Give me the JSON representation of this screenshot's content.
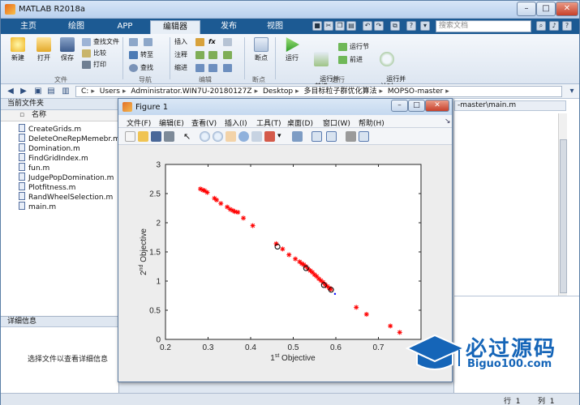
{
  "window": {
    "title": "MATLAB R2018a"
  },
  "ribbon_tabs": [
    {
      "label": "主页"
    },
    {
      "label": "绘图"
    },
    {
      "label": "APP"
    },
    {
      "label": "编辑器"
    },
    {
      "label": "发布"
    },
    {
      "label": "视图"
    }
  ],
  "search": {
    "placeholder": "搜索文档"
  },
  "ribbon": {
    "file": {
      "new": "新建",
      "open": "打开",
      "save": "保存",
      "find_files": "查找文件",
      "compare": "比较",
      "print": "打印",
      "group": "文件"
    },
    "nav": {
      "goto": "转至",
      "find": "查找",
      "group": "导航"
    },
    "edit": {
      "insert": "插入",
      "fx": "fx",
      "comment": "注释",
      "indent": "缩进",
      "group": "编辑"
    },
    "breakpoints": {
      "label": "断点",
      "group": "断点"
    },
    "run": {
      "run": "运行",
      "run_advance": "运行并\n前进",
      "run_section": "运行节",
      "advance": "前进",
      "run_time": "运行并\n计时",
      "group": "运行"
    }
  },
  "address": {
    "segments": [
      "C:",
      "Users",
      "Administrator.WIN7U-20180127Z",
      "Desktop",
      "多目标粒子群优化算法",
      "MOPSO-master"
    ]
  },
  "file_panel": {
    "title": "当前文件夹",
    "column": "名称",
    "files": [
      "CreateGrids.m",
      "DeleteOneRepMemebr.m",
      "Domination.m",
      "FindGridIndex.m",
      "fun.m",
      "JudgePopDomination.m",
      "Plotfitness.m",
      "RandWheelSelection.m",
      "main.m"
    ]
  },
  "details": {
    "title": "详细信息",
    "message": "选择文件以查看详细信息"
  },
  "editor": {
    "tab": "-master\\main.m"
  },
  "status": {
    "row_label": "行",
    "row_value": "1",
    "col_label": "列",
    "col_value": "1"
  },
  "figure": {
    "title": "Figure 1",
    "menus": [
      "文件(F)",
      "编辑(E)",
      "查看(V)",
      "插入(I)",
      "工具(T)",
      "桌面(D)",
      "窗口(W)",
      "帮助(H)"
    ]
  },
  "chart_data": {
    "type": "scatter",
    "xlabel": "1st Objective",
    "ylabel": "2nd Objective",
    "xlim": [
      0.2,
      0.8
    ],
    "ylim": [
      0,
      3
    ],
    "xticks": [
      "0.2",
      "0.3",
      "0.4",
      "0.5",
      "0.6",
      "0.7",
      "0.8"
    ],
    "yticks": [
      "0",
      "0.5",
      "1",
      "1.5",
      "2",
      "2.5",
      "3"
    ],
    "grid": false,
    "series": [
      {
        "marker": "star",
        "color": "#ff0000",
        "points": [
          [
            0.282,
            2.58
          ],
          [
            0.288,
            2.56
          ],
          [
            0.292,
            2.55
          ],
          [
            0.298,
            2.52
          ],
          [
            0.315,
            2.42
          ],
          [
            0.32,
            2.39
          ],
          [
            0.33,
            2.33
          ],
          [
            0.345,
            2.27
          ],
          [
            0.352,
            2.23
          ],
          [
            0.358,
            2.21
          ],
          [
            0.363,
            2.19
          ],
          [
            0.37,
            2.18
          ],
          [
            0.383,
            2.08
          ],
          [
            0.405,
            1.95
          ],
          [
            0.46,
            1.64
          ],
          [
            0.475,
            1.55
          ],
          [
            0.49,
            1.45
          ],
          [
            0.505,
            1.38
          ],
          [
            0.515,
            1.33
          ],
          [
            0.52,
            1.3
          ],
          [
            0.525,
            1.28
          ],
          [
            0.53,
            1.25
          ],
          [
            0.535,
            1.21
          ],
          [
            0.54,
            1.18
          ],
          [
            0.545,
            1.15
          ],
          [
            0.55,
            1.11
          ],
          [
            0.555,
            1.08
          ],
          [
            0.56,
            1.04
          ],
          [
            0.565,
            1.01
          ],
          [
            0.57,
            0.98
          ],
          [
            0.575,
            0.94
          ],
          [
            0.58,
            0.91
          ],
          [
            0.585,
            0.88
          ],
          [
            0.588,
            0.86
          ],
          [
            0.648,
            0.55
          ],
          [
            0.672,
            0.43
          ],
          [
            0.728,
            0.23
          ],
          [
            0.75,
            0.12
          ]
        ]
      },
      {
        "marker": "circle",
        "color": "#000000",
        "points": [
          [
            0.463,
            1.59
          ],
          [
            0.53,
            1.22
          ],
          [
            0.572,
            0.93
          ],
          [
            0.589,
            0.85
          ]
        ]
      },
      {
        "marker": "dot",
        "color": "#0000ff",
        "points": [
          [
            0.598,
            0.78
          ]
        ]
      }
    ]
  }
}
